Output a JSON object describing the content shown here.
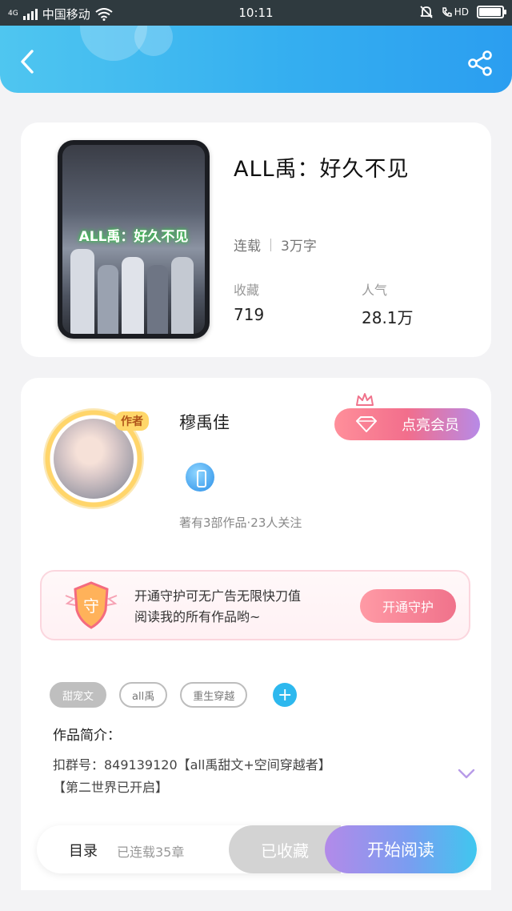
{
  "status_bar": {
    "network_type": "4G",
    "carrier": "中国移动",
    "time": "10:11",
    "hd_label": "HD",
    "battery_level": 0.9
  },
  "header": {
    "back_icon": "chevron-left-icon",
    "share_icon": "share-icon"
  },
  "book": {
    "cover_title": "ALL禹：好久不见",
    "title": "ALL禹：好久不见",
    "status": "连载",
    "word_count": "3万字",
    "favorites_label": "收藏",
    "favorites_value": "719",
    "popularity_label": "人气",
    "popularity_value": "28.1万"
  },
  "author": {
    "badge": "作者",
    "name": "穆禹佳",
    "stats": "著有3部作品·23人关注",
    "vip_button": "点亮会员"
  },
  "guard": {
    "shield_text": "守",
    "text_line1": "开通守护可无广告无限快刀值",
    "text_line2": "阅读我的所有作品哟~",
    "button": "开通守护"
  },
  "tags": {
    "items": [
      "甜宠文",
      "all禹",
      "重生穿越"
    ],
    "add_icon": "plus-icon"
  },
  "intro": {
    "label": "作品简介：",
    "line1": "扣群号：849139120【all禹甜文+空间穿越者】",
    "line2": "【第二世界已开启】"
  },
  "bottom_bar": {
    "toc_label": "目录",
    "toc_count": "已连载35章",
    "favorite_button": "已收藏",
    "read_button": "开始阅读"
  },
  "colors": {
    "header_start": "#4fc6f0",
    "header_end": "#2b9ef0",
    "vip_pink": "#f26e8c",
    "accent_blue": "#2db8ee",
    "read_purple": "#b38ae9"
  }
}
